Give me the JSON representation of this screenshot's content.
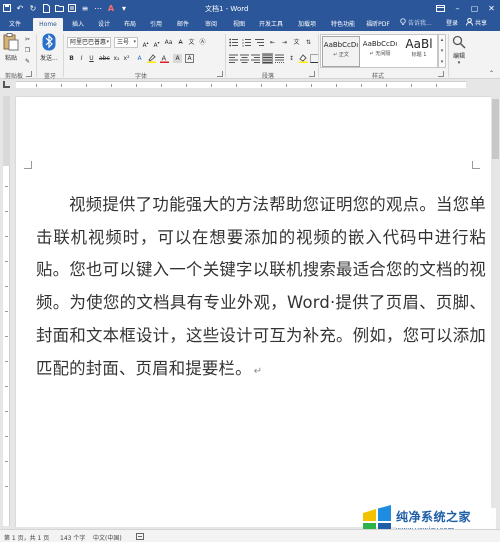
{
  "titlebar": {
    "title": "文档1 - Word",
    "qat": [
      "save-icon",
      "undo-icon",
      "redo-icon",
      "new-icon",
      "open-icon",
      "print-icon",
      "format-icon",
      "more-icon",
      "color-icon",
      "customize-icon"
    ],
    "controls": [
      "ribbon-options-icon",
      "minimize-icon",
      "maximize-icon",
      "close-icon"
    ]
  },
  "tabs": [
    {
      "label": "文件",
      "active": false
    },
    {
      "label": "Home",
      "active": true
    },
    {
      "label": "插入",
      "active": false
    },
    {
      "label": "设计",
      "active": false
    },
    {
      "label": "布局",
      "active": false
    },
    {
      "label": "引用",
      "active": false
    },
    {
      "label": "邮件",
      "active": false
    },
    {
      "label": "审阅",
      "active": false
    },
    {
      "label": "视图",
      "active": false
    },
    {
      "label": "开发工具",
      "active": false
    },
    {
      "label": "加载项",
      "active": false
    },
    {
      "label": "特色功能",
      "active": false
    },
    {
      "label": "福昕PDF",
      "active": false
    }
  ],
  "tell_me": "告诉我...",
  "sign_in": "登录",
  "share": "共享",
  "ribbon": {
    "clipboard": {
      "paste_label": "粘贴",
      "group_label": "剪贴板"
    },
    "bluetooth": {
      "send_label": "发送...",
      "group_label": "蓝牙"
    },
    "font": {
      "font_name": "阿里巴巴普惠",
      "font_size": "三号",
      "group_label": "字体"
    },
    "paragraph": {
      "group_label": "段落"
    },
    "styles": {
      "group_label": "样式",
      "items": [
        {
          "sample": "AaBbCcDı",
          "name": "↵ 正文"
        },
        {
          "sample": "AaBbCcDı",
          "name": "↵ 无间隔"
        },
        {
          "sample": "AaBl",
          "name": "标题 1"
        }
      ]
    },
    "editing": {
      "label": "编辑"
    }
  },
  "document": {
    "body": "视频提供了功能强大的方法帮助您证明您的观点。当您单击联机视频时，可以在想要添加的视频的嵌入代码中进行粘贴。您也可以键入一个关键字以联机搜索最适合您的文档的视频。为使您的文档具有专业外观，Word·提供了页眉、页脚、封面和文本框设计，这些设计可互为补充。例如，您可以添加匹配的封面、页眉和提要栏。",
    "paragraph_mark": "↵"
  },
  "status": {
    "page": "第 1 页，共 1 页",
    "words": "143 个字",
    "language": "中文(中国)"
  },
  "watermark": {
    "title": "纯净系统之家",
    "url": "www.ycwjzy.com"
  },
  "colors": {
    "brand": "#2b579a",
    "ribbon": "#f3f3f3",
    "workspace": "#e6e6e6"
  }
}
